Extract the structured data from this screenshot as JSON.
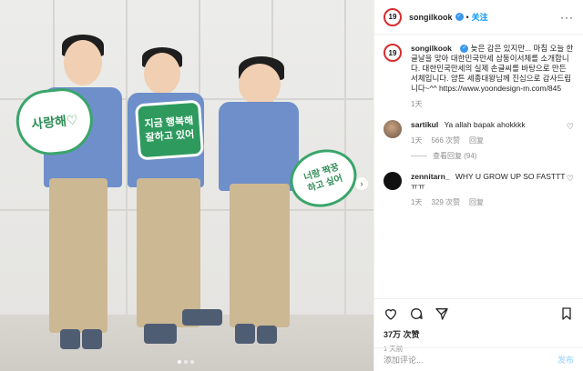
{
  "header": {
    "username": "songilkook",
    "follow_label": "关注",
    "avatar_text": "19"
  },
  "caption": {
    "username": "songilkook",
    "text": "늦은 감은 있지만... 마침 오늘 한글날을 맞아 대한민국만세 삼둥이서체를 소개합니다. 대한민국만세의 실제 손글씨를 바탕으로 만든 서체입니다. 얌튼 세종대왕님께 진심으로 감사드립니다~^^ https://www.yoondesign-m.com/845",
    "time": "1天"
  },
  "comments": [
    {
      "username": "sartikul",
      "text": "Ya allah bapak ahokkkk",
      "time": "1天",
      "likes": "566 次赞",
      "reply": "回复",
      "view_replies": "查看回复 (94)"
    },
    {
      "username": "zennitarn_",
      "text": "WHY U GROW UP SO FASTTTㅠㅠ",
      "time": "1天",
      "likes": "329 次赞",
      "reply": "回复"
    }
  ],
  "post": {
    "likes": "37万 次赞",
    "time_ago": "1 天前"
  },
  "add_comment": {
    "placeholder": "添加评论...",
    "post_label": "发布"
  },
  "signs": {
    "left": "사랑해♡",
    "middle_line1": "지금 행복해",
    "middle_line2": "잘하고 있어",
    "right_line1": "너랑 짝꿍",
    "right_line2": "하고 싶어"
  },
  "carousel": {
    "next_icon": "chevron-right-icon",
    "total_slides": 3,
    "active_slide": 1
  },
  "colors": {
    "accent_blue": "#0095f6",
    "verified_blue": "#3897f0",
    "meta_gray": "#8e8e8e",
    "sign_green": "#2f9a5e"
  }
}
